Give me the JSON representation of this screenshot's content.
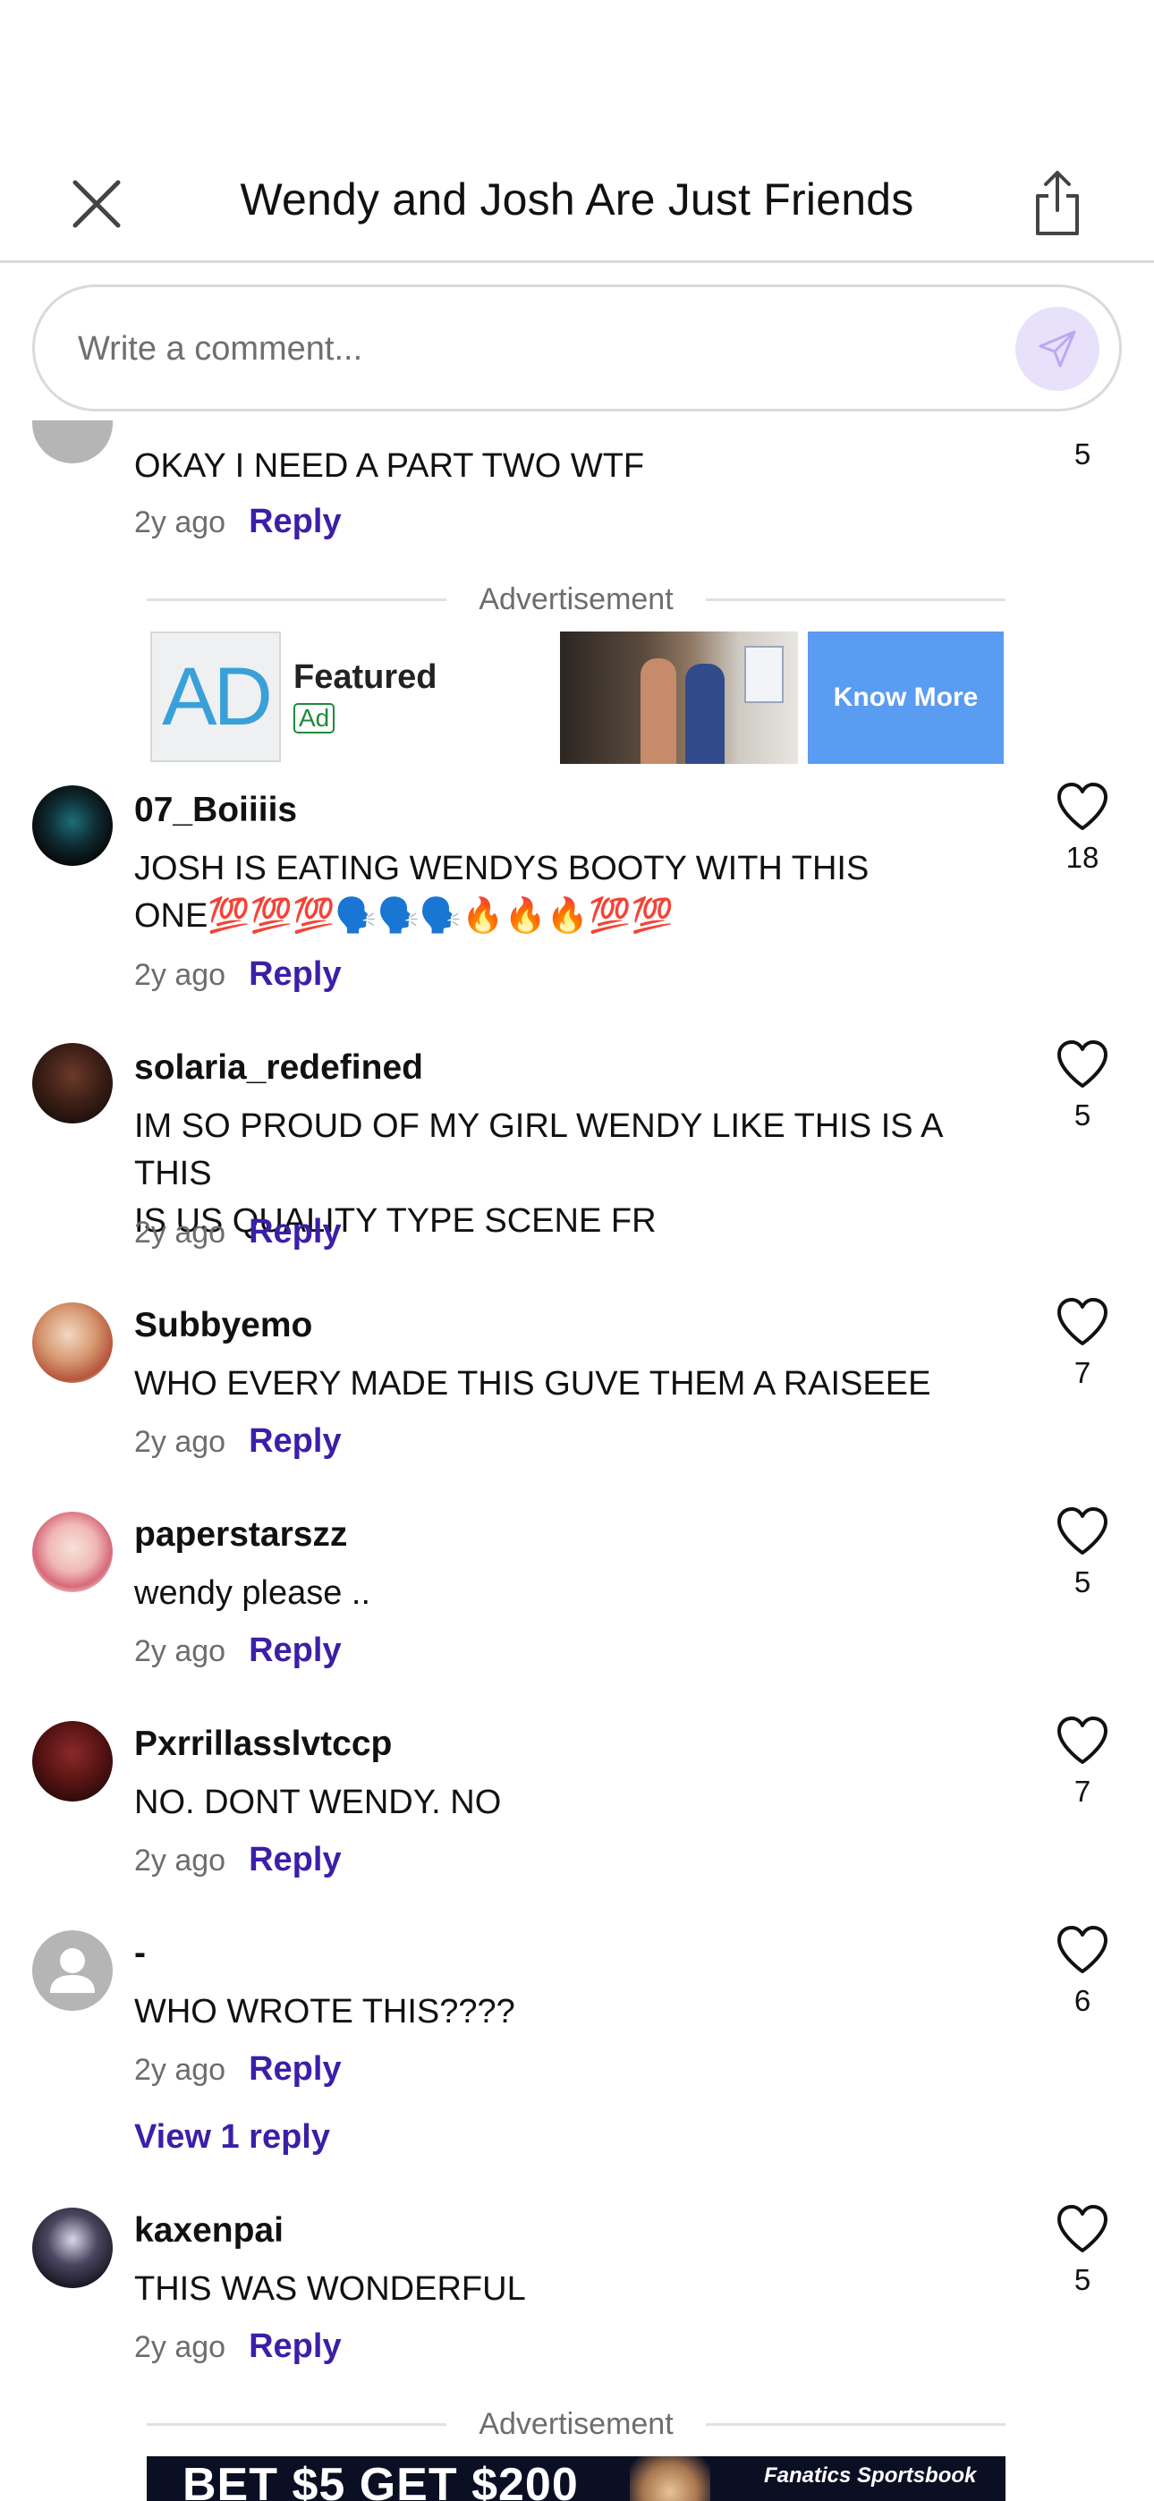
{
  "header": {
    "title": "Wendy and Josh Are Just Friends"
  },
  "composer": {
    "placeholder": "Write a comment..."
  },
  "top_comment": {
    "text": "OKAY I NEED A PART TWO WTF",
    "time": "2y ago",
    "reply": "Reply",
    "likes": "5"
  },
  "ad1": {
    "label": "Advertisement",
    "logo_text": "AD",
    "featured": "Featured",
    "badge": "Ad",
    "cta": "Know More"
  },
  "comments": [
    {
      "username": "07_Boiiiis",
      "text_line1": "JOSH IS EATING WENDYS BOOTY WITH THIS",
      "text_line2": "ONE💯💯💯🗣️🗣️🗣️🔥🔥🔥💯💯",
      "time": "2y ago",
      "reply": "Reply",
      "likes": "18"
    },
    {
      "username": "solaria_redefined",
      "text_line1": "IM SO PROUD OF MY GIRL WENDY LIKE THIS IS A THIS",
      "text_line2": "IS US QUALITY TYPE SCENE FR",
      "time": "2y ago",
      "reply": "Reply",
      "likes": "5"
    },
    {
      "username": "Subbyemo",
      "text": "WHO EVERY MADE THIS GUVE THEM A RAISEEE",
      "time": "2y ago",
      "reply": "Reply",
      "likes": "7"
    },
    {
      "username": "paperstarszz",
      "text": "wendy please ..",
      "time": "2y ago",
      "reply": "Reply",
      "likes": "5"
    },
    {
      "username": "Pxrrillasslvtccp",
      "text": "NO. DONT WENDY. NO",
      "time": "2y ago",
      "reply": "Reply",
      "likes": "7"
    },
    {
      "username": "-",
      "text": "WHO WROTE THIS????",
      "time": "2y ago",
      "reply": "Reply",
      "likes": "6",
      "view_replies": "View 1 reply"
    },
    {
      "username": "kaxenpai",
      "text": "THIS WAS WONDERFUL",
      "time": "2y ago",
      "reply": "Reply",
      "likes": "5"
    }
  ],
  "ad2": {
    "label": "Advertisement",
    "banner_text": "BET $5 GET $200",
    "brand": "Fanatics Sportsbook"
  },
  "colors": {
    "accent": "#3b1fa8",
    "send_bg": "#e7e1fb",
    "ad_cta": "#5a9cf2"
  }
}
